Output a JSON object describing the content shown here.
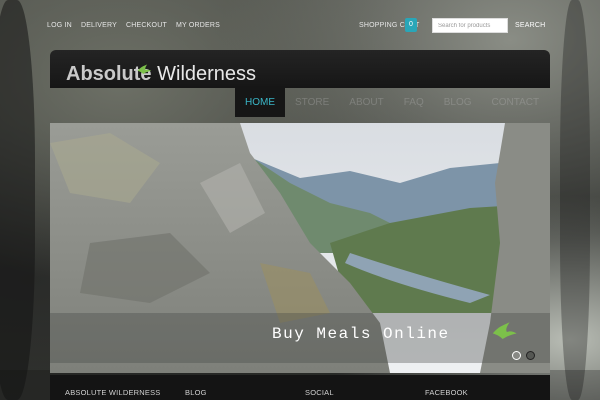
{
  "topbar": {
    "links": [
      "LOG IN",
      "DELIVERY",
      "CHECKOUT",
      "MY ORDERS"
    ],
    "cart_label": "SHOPPING CART",
    "cart_count": "0",
    "search_placeholder": "Search for products",
    "search_button": "SEARCH"
  },
  "header": {
    "logo_word1": "Absolute",
    "logo_word2": "Wilderness"
  },
  "nav": {
    "items": [
      {
        "label": "HOME",
        "active": true
      },
      {
        "label": "STORE",
        "active": false
      },
      {
        "label": "ABOUT",
        "active": false
      },
      {
        "label": "FAQ",
        "active": false
      },
      {
        "label": "BLOG",
        "active": false
      },
      {
        "label": "CONTACT",
        "active": false
      }
    ]
  },
  "slider": {
    "caption": "Buy Meals Online",
    "slide_count": 2,
    "active_slide": 1
  },
  "footer": {
    "columns": [
      "ABSOLUTE WILDERNESS",
      "BLOG",
      "SOCIAL",
      "FACEBOOK"
    ]
  },
  "colors": {
    "accent": "#29a6b8",
    "nav_active_text": "#3ab7c8",
    "bird_green": "#7cc04a",
    "header_bg": "#1c1c1c"
  }
}
